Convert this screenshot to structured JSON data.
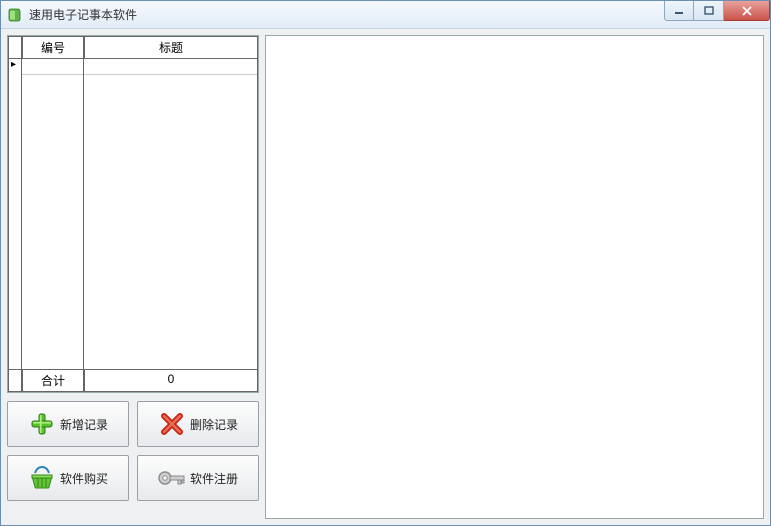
{
  "window": {
    "title": "速用电子记事本软件"
  },
  "grid": {
    "headers": {
      "id": "编号",
      "title": "标题"
    },
    "footer": {
      "label": "合计",
      "count": "0"
    }
  },
  "buttons": {
    "add": "新增记录",
    "delete": "删除记录",
    "buy": "软件购买",
    "register": "软件注册"
  }
}
